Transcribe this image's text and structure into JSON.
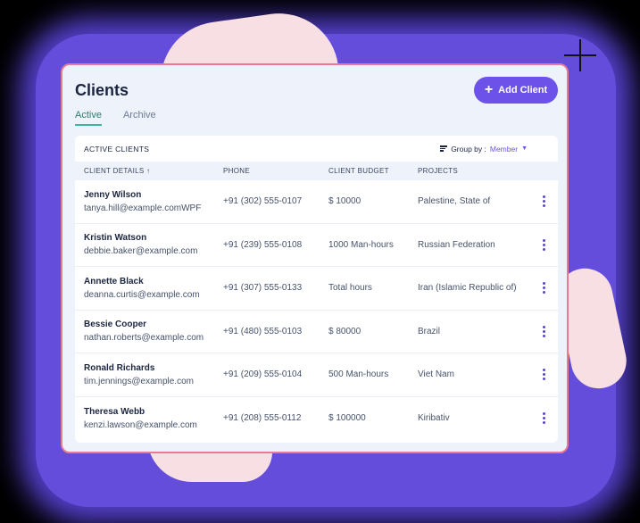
{
  "header": {
    "title": "Clients",
    "add_button_label": "Add Client"
  },
  "tabs": [
    {
      "label": "Active",
      "active": true
    },
    {
      "label": "Archive",
      "active": false
    }
  ],
  "panel": {
    "title": "ACTIVE CLIENTS",
    "group_by_label": "Group by :",
    "group_by_value": "Member"
  },
  "table": {
    "columns": [
      "CLIENT DETAILS ↑",
      "PHONE",
      "CLIENT BUDGET",
      "PROJECTS"
    ],
    "rows": [
      {
        "name": "Jenny Wilson",
        "email": "tanya.hill@example.comWPF",
        "phone": "+91 (302) 555-0107",
        "budget": "$ 10000",
        "project": "Palestine, State of"
      },
      {
        "name": "Kristin Watson",
        "email": "debbie.baker@example.com",
        "phone": "+91 (239) 555-0108",
        "budget": "1000 Man-hours",
        "project": "Russian Federation"
      },
      {
        "name": "Annette Black",
        "email": "deanna.curtis@example.com",
        "phone": "+91 (307) 555-0133",
        "budget": "Total hours",
        "project": "Iran (Islamic Republic of)"
      },
      {
        "name": "Bessie Cooper",
        "email": "nathan.roberts@example.com",
        "phone": "+91 (480) 555-0103",
        "budget": "$ 80000",
        "project": "Brazil"
      },
      {
        "name": "Ronald Richards",
        "email": "tim.jennings@example.com",
        "phone": "+91 (209) 555-0104",
        "budget": "500 Man-hours",
        "project": "Viet Nam"
      },
      {
        "name": "Theresa Webb",
        "email": "kenzi.lawson@example.com",
        "phone": "+91 (208) 555-0112",
        "budget": "$ 100000",
        "project": "Kiribativ"
      }
    ]
  },
  "colors": {
    "accent": "#6c52e8",
    "tab_active_underline": "#3eb7a2",
    "card_border": "#e77b94"
  },
  "icons": [
    "plus-icon",
    "filter-icon",
    "caret-down-icon",
    "kebab-menu-icon",
    "sparkle-icon"
  ]
}
